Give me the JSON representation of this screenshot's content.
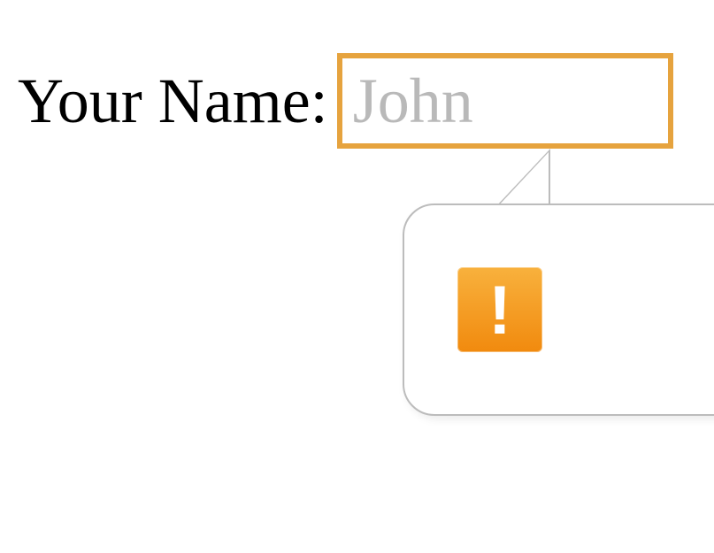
{
  "form": {
    "name_label": "Your Name:",
    "name_placeholder": "John",
    "name_value": ""
  },
  "tooltip": {
    "icon": "warning-icon",
    "glyph": "!"
  },
  "colors": {
    "input_border": "#e6a33e",
    "placeholder": "#b9b9b9",
    "tooltip_border": "#bcbcbc",
    "warning_bg_top": "#f8b13d",
    "warning_bg_bottom": "#f18a0e"
  }
}
